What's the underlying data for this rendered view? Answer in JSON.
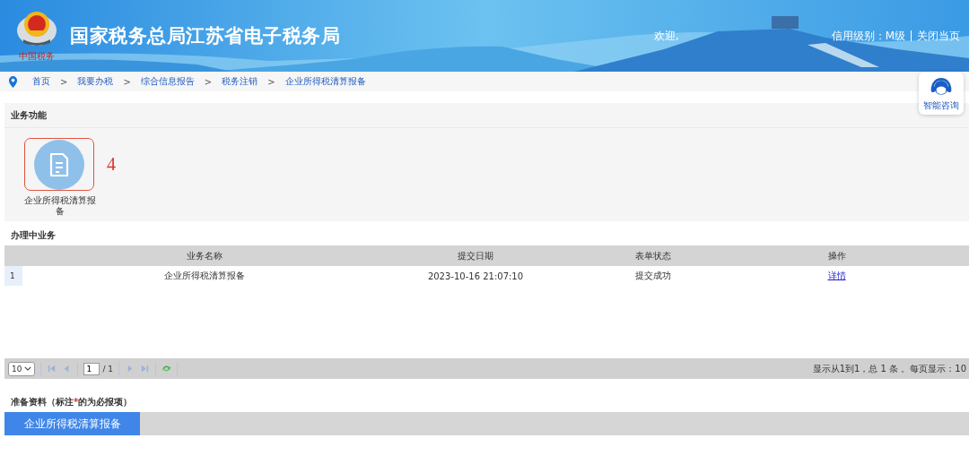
{
  "header": {
    "logo_caption": "中国税务",
    "title": "国家税务总局江苏省电子税务局",
    "welcome": "欢迎,",
    "credit": "信用级别：M级",
    "close": "关闭当页"
  },
  "breadcrumb": [
    "首页",
    "我要办税",
    "综合信息报告",
    "税务注销",
    "企业所得税清算报备"
  ],
  "breadcrumb_separator": ">",
  "assistant": {
    "label": "智能咨询"
  },
  "functions": {
    "title": "业务功能",
    "items": [
      {
        "label": "企业所得税清算报备",
        "selected": true
      }
    ],
    "annotation": "4"
  },
  "in_progress": {
    "title": "办理中业务",
    "columns": [
      "业务名称",
      "提交日期",
      "表单状态",
      "操作"
    ],
    "rows": [
      {
        "index": "1",
        "name": "企业所得税清算报备",
        "date": "2023-10-16 21:07:10",
        "status": "提交成功",
        "action": "详情"
      }
    ]
  },
  "pager": {
    "page_size": "10",
    "page": "1",
    "total_pages": "/ 1",
    "summary": "显示从1到1，总 1 条 。每页显示：10"
  },
  "materials": {
    "title_before": "准备资料（标注",
    "required_mark": "*",
    "title_after": "的为必报项）",
    "tabs": [
      {
        "label": "企业所得税清算报备",
        "selected": true
      }
    ]
  }
}
